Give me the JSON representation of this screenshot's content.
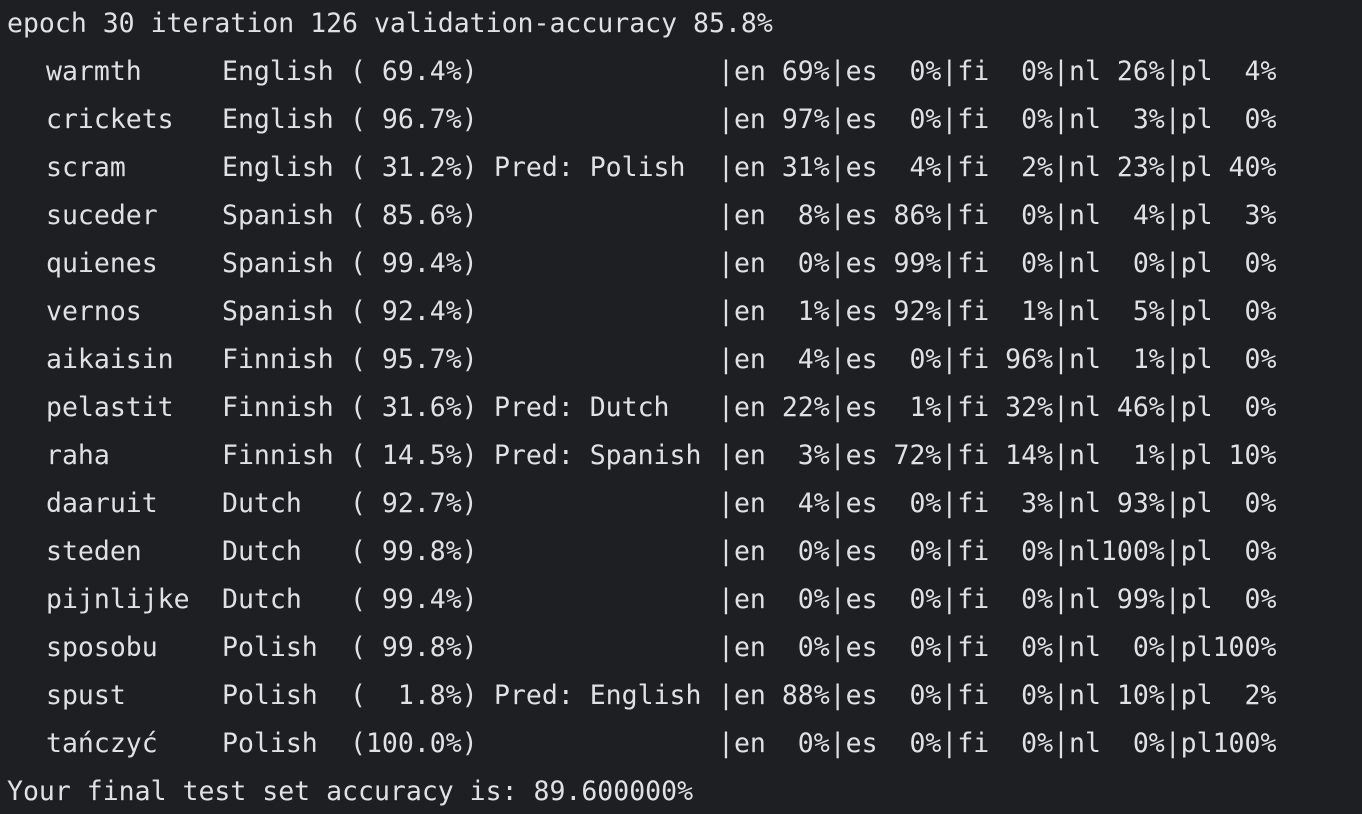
{
  "header": "epoch 30 iteration 126 validation-accuracy 85.8%",
  "rows": [
    {
      "word": "warmth",
      "lang": "English",
      "pct": "( 69.4%)",
      "pred": "",
      "probs": "|en 69%|es  0%|fi  0%|nl 26%|pl  4%"
    },
    {
      "word": "crickets",
      "lang": "English",
      "pct": "( 96.7%)",
      "pred": "",
      "probs": "|en 97%|es  0%|fi  0%|nl  3%|pl  0%"
    },
    {
      "word": "scram",
      "lang": "English",
      "pct": "( 31.2%)",
      "pred": "Pred: Polish",
      "probs": "|en 31%|es  4%|fi  2%|nl 23%|pl 40%"
    },
    {
      "word": "suceder",
      "lang": "Spanish",
      "pct": "( 85.6%)",
      "pred": "",
      "probs": "|en  8%|es 86%|fi  0%|nl  4%|pl  3%"
    },
    {
      "word": "quienes",
      "lang": "Spanish",
      "pct": "( 99.4%)",
      "pred": "",
      "probs": "|en  0%|es 99%|fi  0%|nl  0%|pl  0%"
    },
    {
      "word": "vernos",
      "lang": "Spanish",
      "pct": "( 92.4%)",
      "pred": "",
      "probs": "|en  1%|es 92%|fi  1%|nl  5%|pl  0%"
    },
    {
      "word": "aikaisin",
      "lang": "Finnish",
      "pct": "( 95.7%)",
      "pred": "",
      "probs": "|en  4%|es  0%|fi 96%|nl  1%|pl  0%"
    },
    {
      "word": "pelastit",
      "lang": "Finnish",
      "pct": "( 31.6%)",
      "pred": "Pred: Dutch",
      "probs": "|en 22%|es  1%|fi 32%|nl 46%|pl  0%"
    },
    {
      "word": "raha",
      "lang": "Finnish",
      "pct": "( 14.5%)",
      "pred": "Pred: Spanish",
      "probs": "|en  3%|es 72%|fi 14%|nl  1%|pl 10%"
    },
    {
      "word": "daaruit",
      "lang": "Dutch",
      "pct": "( 92.7%)",
      "pred": "",
      "probs": "|en  4%|es  0%|fi  3%|nl 93%|pl  0%"
    },
    {
      "word": "steden",
      "lang": "Dutch",
      "pct": "( 99.8%)",
      "pred": "",
      "probs": "|en  0%|es  0%|fi  0%|nl100%|pl  0%"
    },
    {
      "word": "pijnlijke",
      "lang": "Dutch",
      "pct": "( 99.4%)",
      "pred": "",
      "probs": "|en  0%|es  0%|fi  0%|nl 99%|pl  0%"
    },
    {
      "word": "sposobu",
      "lang": "Polish",
      "pct": "( 99.8%)",
      "pred": "",
      "probs": "|en  0%|es  0%|fi  0%|nl  0%|pl100%"
    },
    {
      "word": "spust",
      "lang": "Polish",
      "pct": "(  1.8%)",
      "pred": "Pred: English",
      "probs": "|en 88%|es  0%|fi  0%|nl 10%|pl  2%"
    },
    {
      "word": "tańczyć",
      "lang": "Polish",
      "pct": "(100.0%)",
      "pred": "",
      "probs": "|en  0%|es  0%|fi  0%|nl  0%|pl100%"
    }
  ],
  "footer": "Your final test set accuracy is: 89.600000%"
}
